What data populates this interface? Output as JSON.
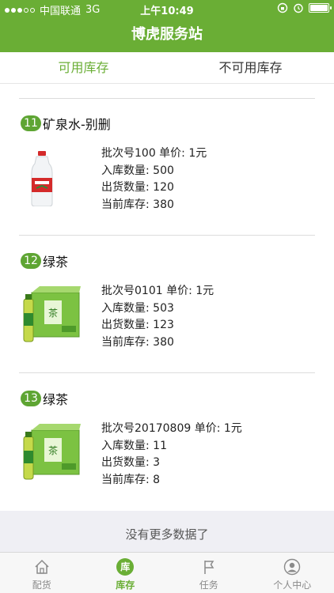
{
  "status_bar": {
    "carrier": "中国联通",
    "network": "3G",
    "time": "上午10:49",
    "signal_dots_filled": 3,
    "signal_dots_total": 5,
    "battery_level": 1.0
  },
  "navbar": {
    "title": "博虎服务站"
  },
  "tabs": [
    {
      "label": "可用库存",
      "active": true
    },
    {
      "label": "不可用库存",
      "active": false
    }
  ],
  "items": [
    {
      "index": "11",
      "name": "矿泉水-别删",
      "batch_line": "批次号100   单价: 1元",
      "inbound_line": "入库数量: 500",
      "outbound_line": "出货数量: 120",
      "stock_line": "当前库存: 380",
      "image": "water-bottle-icon"
    },
    {
      "index": "12",
      "name": "绿茶",
      "batch_line": "批次号0101   单价: 1元",
      "inbound_line": "入库数量: 503",
      "outbound_line": "出货数量: 123",
      "stock_line": "当前库存: 380",
      "image": "green-tea-box-icon"
    },
    {
      "index": "13",
      "name": "绿茶",
      "batch_line": "批次号20170809   单价: 1元",
      "inbound_line": "入库数量: 11",
      "outbound_line": "出货数量: 3",
      "stock_line": "当前库存: 8",
      "image": "green-tea-box-icon"
    }
  ],
  "footer_message": "没有更多数据了",
  "tabbar": [
    {
      "label": "配货",
      "icon": "home-icon",
      "active": false
    },
    {
      "label": "库存",
      "icon": "ku-icon",
      "icon_text": "库",
      "active": true
    },
    {
      "label": "任务",
      "icon": "flag-icon",
      "active": false
    },
    {
      "label": "个人中心",
      "icon": "user-icon",
      "active": false
    }
  ],
  "colors": {
    "brand": "#6aae35",
    "badge": "#5ea533",
    "footer_bg": "#efeff4"
  }
}
